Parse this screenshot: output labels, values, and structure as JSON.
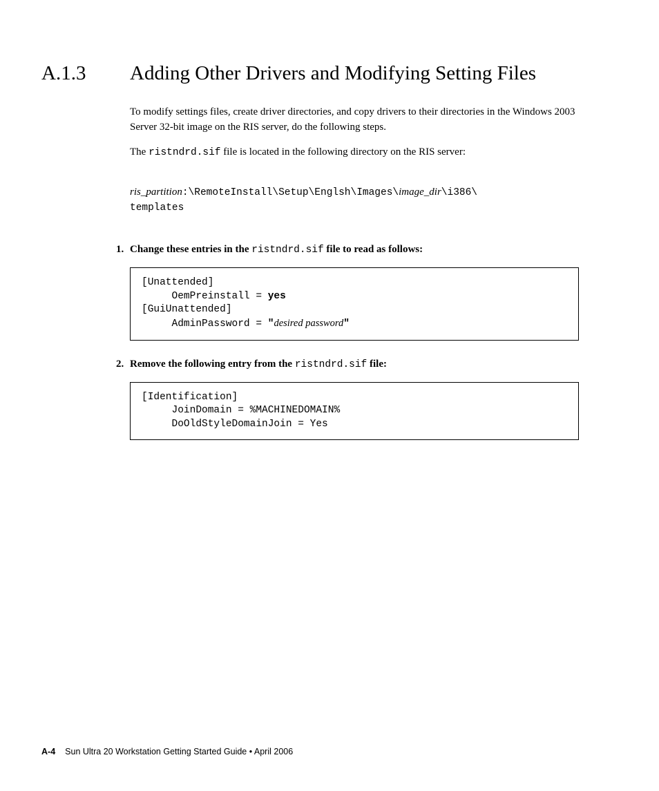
{
  "heading": {
    "number": "A.1.3",
    "title": "Adding Other Drivers and Modifying Setting Files"
  },
  "intro": {
    "p1": "To modify settings files, create driver directories, and copy drivers to their directories in the Windows 2003 Server 32-bit image on the RIS server, do the following steps.",
    "p2_pre": "The ",
    "p2_file": "ristndrd.sif",
    "p2_post": " file is located in the following directory on the RIS server:",
    "path_part1_italic": "ris_partition",
    "path_part2": ":\\RemoteInstall\\Setup\\Englsh\\Images\\",
    "path_part3_italic": "image_dir",
    "path_part4": "\\i386\\\ntemplates"
  },
  "steps": {
    "s1": {
      "num": "1.",
      "pre": "Change these entries in the ",
      "file": "ristndrd.sif",
      "mid": " file",
      "post": " to read as follows:",
      "code": {
        "l1": "[Unattended]",
        "l2": "     OemPreinstall = ",
        "l2b": "yes",
        "l3": "[GuiUnattended]",
        "l4": "     AdminPassword = ",
        "l4q1": "\"",
        "l4i": "desired password",
        "l4q2": "\""
      }
    },
    "s2": {
      "num": "2.",
      "pre": "Remove the following entry from the ",
      "file": "ristndrd.sif",
      "mid": " file",
      "post": ":",
      "code": {
        "l1": "[Identification]",
        "l2": "     JoinDomain = %MACHINEDOMAIN%",
        "l3": "     DoOldStyleDomainJoin = Yes"
      }
    }
  },
  "footer": {
    "page": "A-4",
    "text": "Sun Ultra 20 Workstation Getting Started Guide • April 2006"
  }
}
